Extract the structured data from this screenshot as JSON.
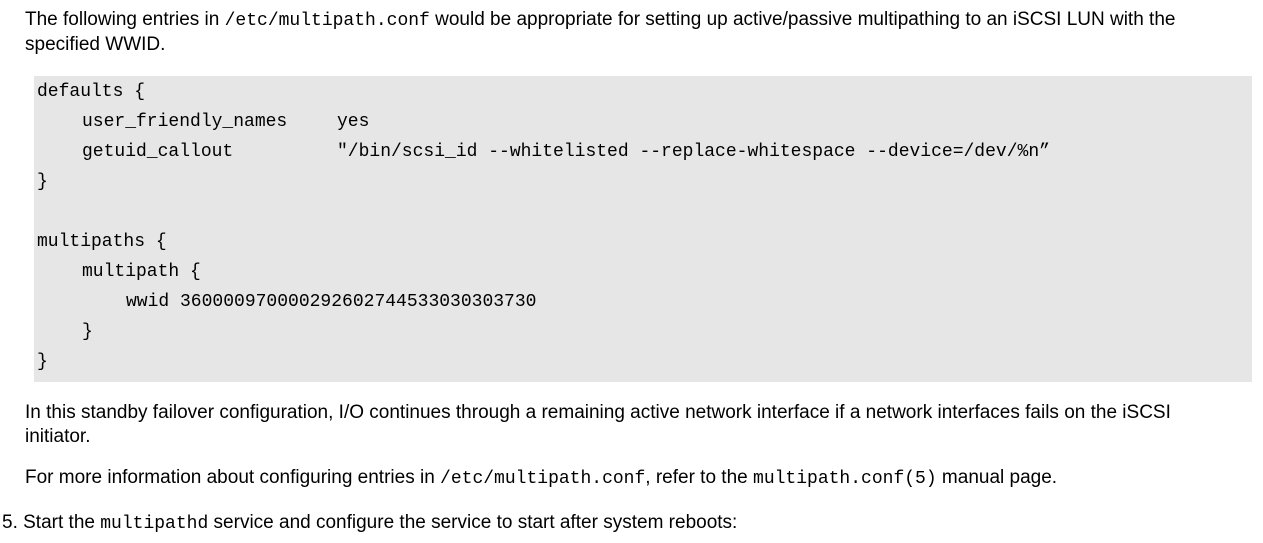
{
  "intro": {
    "before": "The following entries in ",
    "path": "/etc/multipath.conf",
    "after": " would be appropriate for setting up active/passive multipathing to an iSCSI LUN with the specified WWID."
  },
  "code": {
    "line1": "defaults {",
    "line2_key": "user_friendly_names",
    "line2_value": "yes",
    "line3_key": "getuid_callout",
    "line3_value": "\"/bin/scsi_id --whitelisted --replace-whitespace --device=/dev/%n”",
    "line4": "}",
    "line5": "multipaths {",
    "line6": "multipath {",
    "line7": "wwid 360000970000292602744533030303730",
    "line8": "}",
    "line9": "}"
  },
  "failover": {
    "text": "In this standby failover configuration, I/O continues through a remaining active network interface if a network interfaces fails on the iSCSI initiator."
  },
  "moreinfo": {
    "before": "For more information about configuring entries in ",
    "path": "/etc/multipath.conf",
    "middle": ", refer to the ",
    "manpage": "multipath.conf(5)",
    "after": " manual page."
  },
  "step5": {
    "number": "5.",
    "before": " Start the ",
    "service": "multipathd",
    "after": " service and configure the service to start after system reboots:"
  }
}
